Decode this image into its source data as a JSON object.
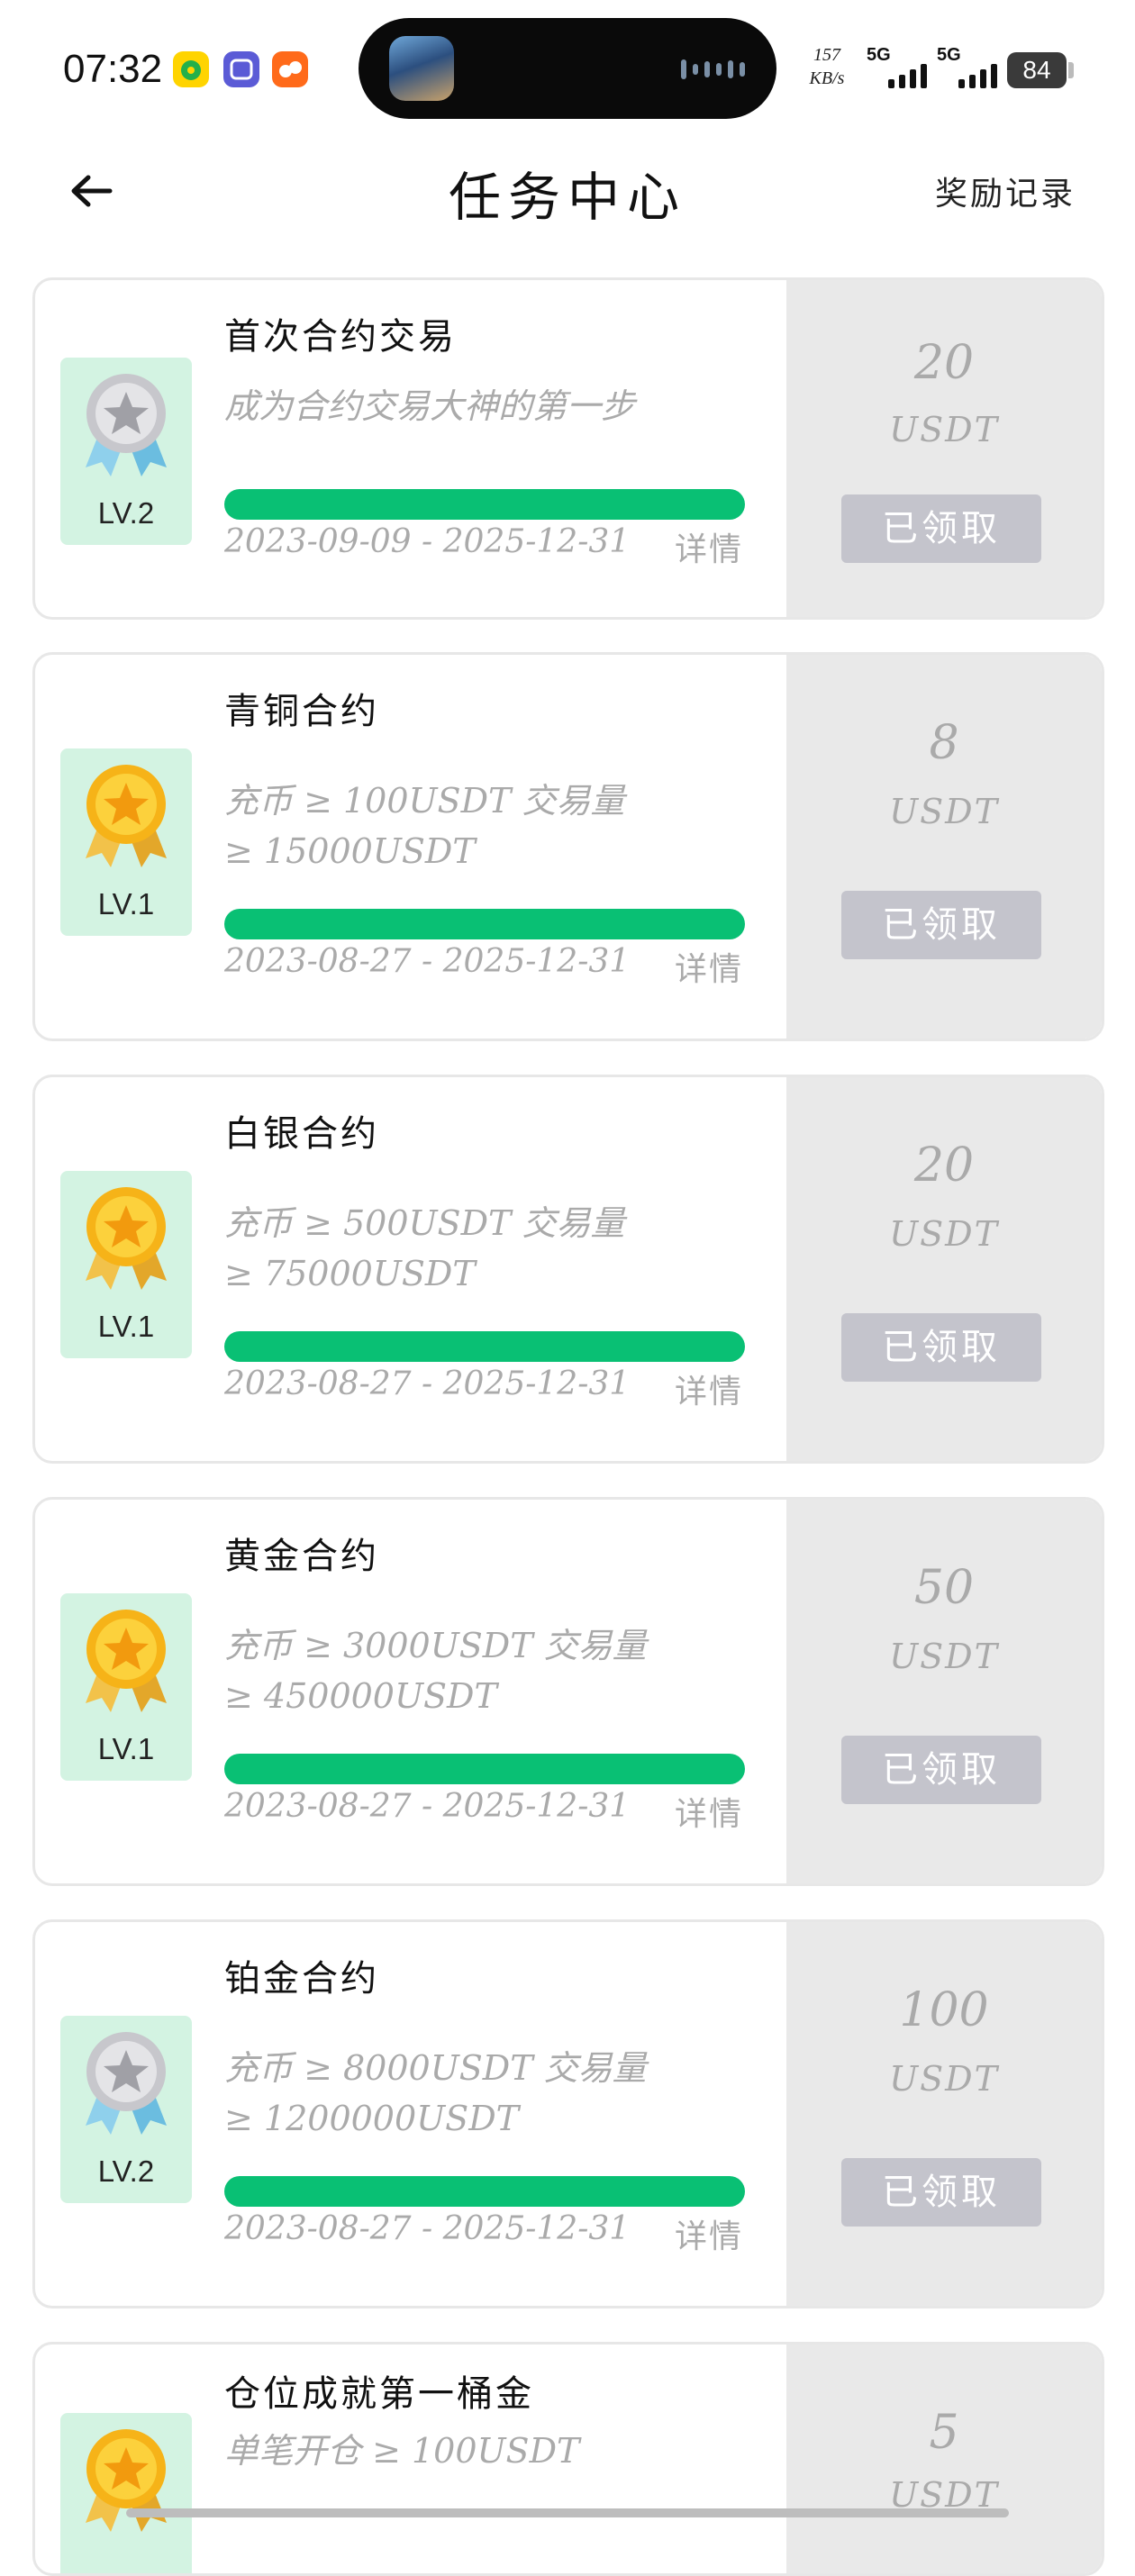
{
  "status_bar": {
    "time": "07:32",
    "net_speed_value": "157",
    "net_speed_unit": "KB/s",
    "sim1": "5G",
    "sim2": "5G",
    "battery": "84"
  },
  "header": {
    "title": "任务中心",
    "right_link": "奖励记录"
  },
  "tasks": [
    {
      "name": "首次合约交易",
      "desc": "成为合约交易大神的第一步",
      "level": "LV.2",
      "medal": "silver",
      "dates": "2023-09-09 - 2025-12-31",
      "detail": "详情",
      "reward": "20",
      "unit": "USDT",
      "button": "已领取",
      "progress": 1.0
    },
    {
      "name": "青铜合约",
      "desc": "充币 ≥ 100USDT 交易量 ≥ 15000USDT",
      "level": "LV.1",
      "medal": "gold",
      "dates": "2023-08-27 - 2025-12-31",
      "detail": "详情",
      "reward": "8",
      "unit": "USDT",
      "button": "已领取",
      "progress": 1.0
    },
    {
      "name": "白银合约",
      "desc": "充币 ≥ 500USDT 交易量 ≥ 75000USDT",
      "level": "LV.1",
      "medal": "gold",
      "dates": "2023-08-27 - 2025-12-31",
      "detail": "详情",
      "reward": "20",
      "unit": "USDT",
      "button": "已领取",
      "progress": 1.0
    },
    {
      "name": "黄金合约",
      "desc": "充币 ≥ 3000USDT 交易量 ≥ 450000USDT",
      "level": "LV.1",
      "medal": "gold",
      "dates": "2023-08-27 - 2025-12-31",
      "detail": "详情",
      "reward": "50",
      "unit": "USDT",
      "button": "已领取",
      "progress": 1.0
    },
    {
      "name": "铂金合约",
      "desc": "充币 ≥ 8000USDT 交易量 ≥ 1200000USDT",
      "level": "LV.2",
      "medal": "silver",
      "dates": "2023-08-27 - 2025-12-31",
      "detail": "详情",
      "reward": "100",
      "unit": "USDT",
      "button": "已领取",
      "progress": 1.0
    },
    {
      "name": "仓位成就第一桶金",
      "desc": "单笔开仓 ≥ 100USDT",
      "level": "",
      "medal": "gold",
      "dates": "",
      "detail": "",
      "reward": "5",
      "unit": "USDT",
      "button": "",
      "progress": 0
    }
  ],
  "colors": {
    "progress": "#09c074",
    "badge_bg": "#d3f3e2",
    "right_panel": "#e9e9e9",
    "claimed_button": "#c4c4cc",
    "muted_text": "#aaaaaa"
  },
  "icons": [
    "back-arrow-icon",
    "silver-medal-icon",
    "gold-medal-icon",
    "signal-icon",
    "battery-icon"
  ]
}
